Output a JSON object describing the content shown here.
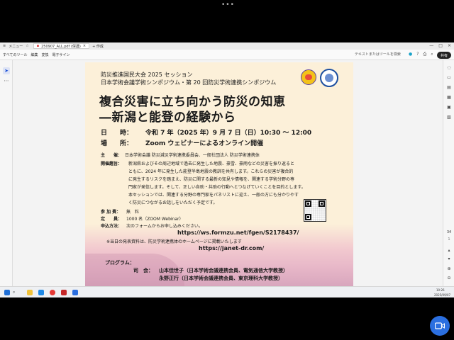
{
  "tabbar": {
    "menu_label": "メニュー",
    "tab_title": "250907_ALL.pdf (保護)",
    "new_tab_label": "+ 作成"
  },
  "menubar": {
    "items": [
      "すべてのツール",
      "編集",
      "変換",
      "電子サイン"
    ],
    "search_text": "テキストまたはツールを検索",
    "share_label": "共有"
  },
  "document": {
    "header1": "防災推進国民大会 2025 セッション",
    "header2": "日本学術会議学術シンポジウム・第 20 回防災学術連携シンポジウム",
    "title1": "複合災害に立ち向かう防災の知恵",
    "title2": "―新潟と能登の経験から",
    "date_label": "日　　時：",
    "date_value": "令和 7 年（2025 年）9 月 7 日（日）10:30 ～ 12:00",
    "place_label": "場　　所：",
    "place_value": "Zoom ウェビナーによるオンライン開催",
    "host_label": "主　　催：",
    "host_value": "日本学術会議 防災減災学術連携委員会、一般社団法人 防災学術連携体",
    "purpose_label": "開催趣旨：",
    "purpose_lines": [
      "新潟県およびその周辺地域で過去に発生した地震、豪雪、豪雨などの災害を振り返ると",
      "ともに、2024 年に発生した能登半島地震の教訓を共有します。これらの災害が複合的",
      "に発生するリスクを踏まえ、防災に関する最新の知見や情報を、関連する学術分野の専",
      "門家が発信します。そして、正しい自助・共助の行動へとつなげていくことを目的とします。",
      "本セッションでは、関連する分野の専門家をパネリストに迎え、一般の方にも分かりやす",
      "く防災につながるお話しをいただく予定です。"
    ],
    "fee_label": "参 加 費：",
    "fee_value": "無　料",
    "cap_label": "定　　員：",
    "cap_value": "1000 名（ZOOM Webinar）",
    "apply_label": "申込方法：",
    "apply_value": "次のフォームからお申し込みください。",
    "url1": "https://ws.formzu.net/fgen/S2178437/",
    "note": "※当日の発表資料は、防災学術連携体のホームページに掲載いたします",
    "url2": "https://janet-dr.com/",
    "program_label": "プログラム：",
    "mc_label": "司　会：",
    "mc1": "山本佳世子（日本学術会議連携会員、電気通信大学教授）",
    "mc2": "永野正行（日本学術会議連携会員、東京理科大学教授）"
  },
  "sidebar_right": {
    "page_number": "34",
    "page_total": "1"
  },
  "taskbar": {
    "time": "10:26",
    "date": "2025/09/07"
  },
  "icons": [
    "menu-icon",
    "star-icon",
    "pdf-icon",
    "close-icon",
    "select-arrow-icon",
    "more-icon",
    "search-icon",
    "zoom-in-icon",
    "zoom-out-icon",
    "video-camera-icon"
  ],
  "colors": {
    "page_bg": "#fcf0d9",
    "accent": "#2b6fe0",
    "share_bg": "#222222"
  }
}
